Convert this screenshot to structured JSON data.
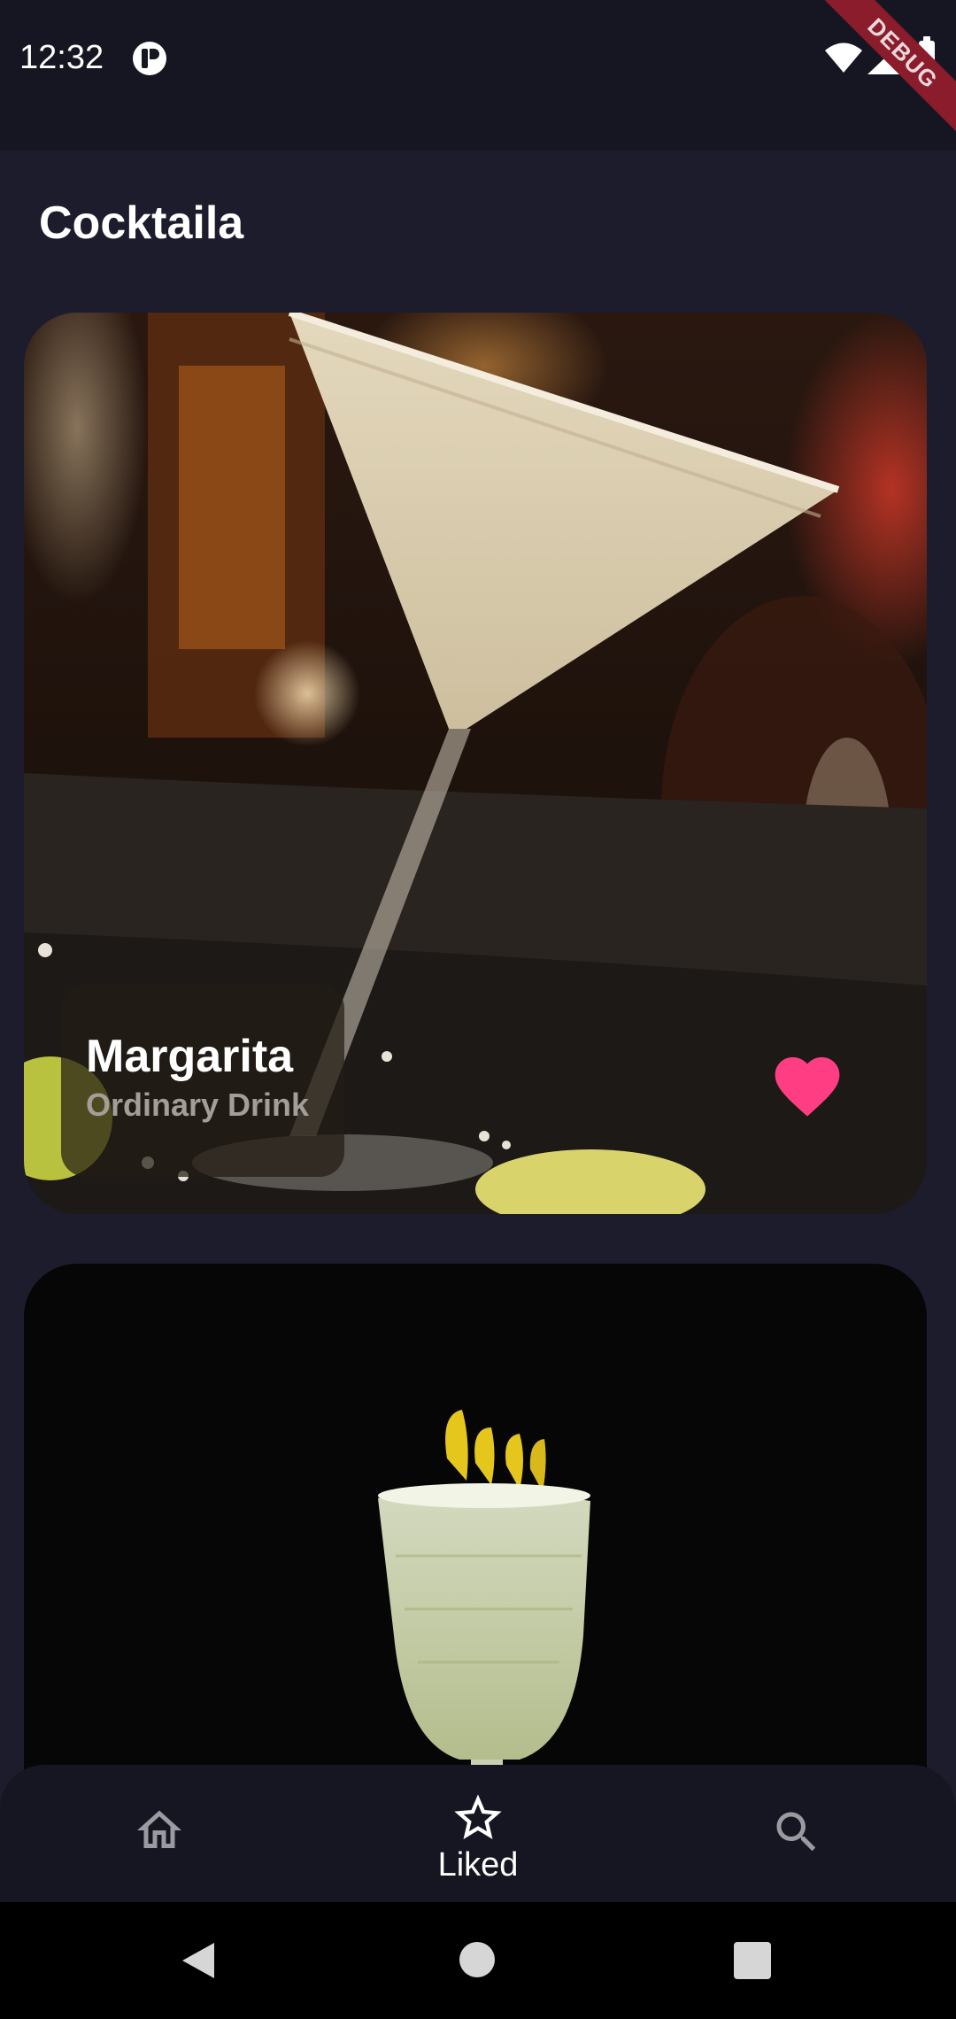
{
  "status_bar": {
    "time": "12:32",
    "debug_label": "DEBUG"
  },
  "app_bar": {
    "title": "Cocktaila"
  },
  "cards": [
    {
      "name": "Margarita",
      "category": "Ordinary Drink",
      "liked": true,
      "like_color": "#ff3d83"
    },
    {
      "name": "",
      "category": ""
    }
  ],
  "bottom_nav": {
    "items": [
      {
        "icon": "home-icon"
      },
      {
        "icon": "star-outline-icon",
        "label": "Liked",
        "selected": true
      },
      {
        "icon": "search-icon"
      }
    ]
  },
  "colors": {
    "background": "#1d1c2c",
    "bar": "#161622",
    "accent": "#ff3d83"
  }
}
